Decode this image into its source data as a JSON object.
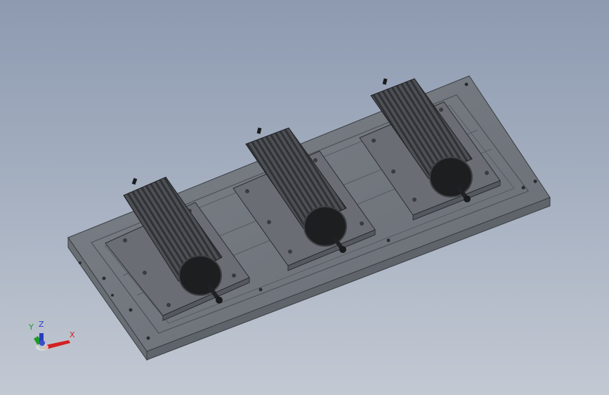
{
  "viewport": {
    "background_top": "#8d9ab0",
    "background_bottom": "#c3c9d3"
  },
  "triad": {
    "x_label": "X",
    "y_label": "Y",
    "z_label": "Z",
    "x_color": "#d42020",
    "y_color": "#1e9a2a",
    "z_color": "#2a3cc0"
  },
  "model": {
    "base_plate_color": "#6f747b",
    "resistor_count": 3
  }
}
